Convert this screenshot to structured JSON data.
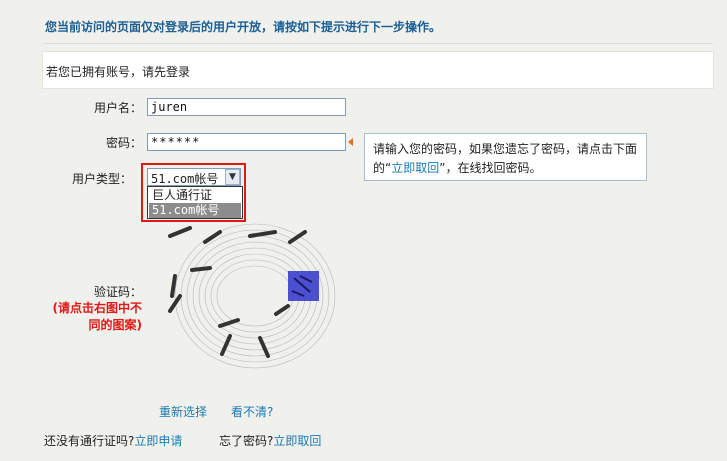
{
  "notice": "您当前访问的页面仅对登录后的用户开放，请按如下提示进行下一步操作。",
  "login_prompt": "若您已拥有账号，请先登录",
  "form": {
    "username_label": "用户名：",
    "username_value": "juren",
    "password_label": "密码：",
    "password_value": "******",
    "usertype_label": "用户类型：",
    "usertype_selected": "51.com帐号",
    "usertype_options": [
      "巨人通行证",
      "51.com帐号"
    ],
    "captcha_label": "验证码：",
    "captcha_note_line1": "(请点击右图中不",
    "captcha_note_line2": "同的图案)"
  },
  "tip": {
    "line1": "请输入您的密码，如果您遗忘了密码，请点击下面",
    "line2_pre": "的“",
    "line2_link": "立即取回",
    "line2_post": "”，在线找回密码。"
  },
  "captcha_actions": {
    "reselect": "重新选择",
    "unclear": "看不清?"
  },
  "footer": {
    "no_pass_text": "还没有通行证吗?",
    "apply_link": "立即申请",
    "forgot_text": "忘了密码?",
    "retrieve_link": "立即取回"
  },
  "colors": {
    "notice": "#1b5f94",
    "link": "#1a7ab5",
    "alert": "#e01818"
  }
}
